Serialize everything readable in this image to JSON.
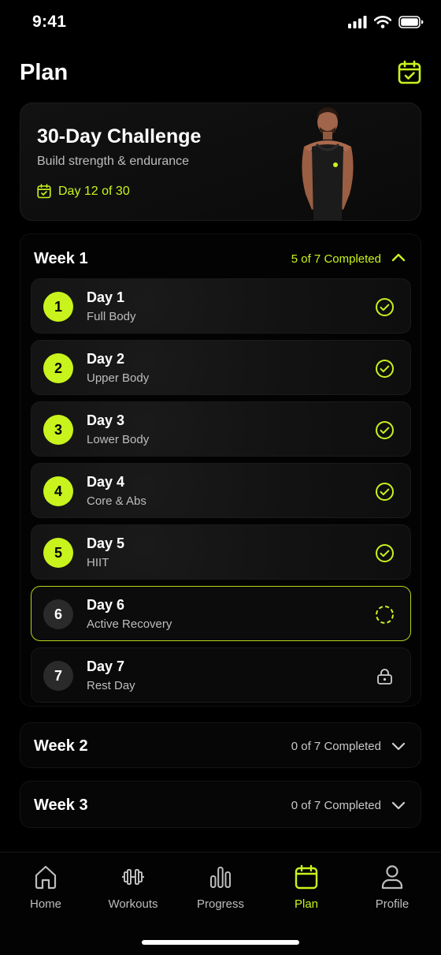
{
  "status_bar": {
    "time": "9:41"
  },
  "header": {
    "title": "Plan"
  },
  "challenge": {
    "title": "30-Day Challenge",
    "subtitle": "Build strength & endurance",
    "day_progress": "Day 12 of 30"
  },
  "weeks": [
    {
      "title": "Week 1",
      "progress": "5 of 7 Completed",
      "expanded": true,
      "days": [
        {
          "number": "1",
          "name": "Day 1",
          "workout": "Full Body",
          "status": "completed"
        },
        {
          "number": "2",
          "name": "Day 2",
          "workout": "Upper Body",
          "status": "completed"
        },
        {
          "number": "3",
          "name": "Day 3",
          "workout": "Lower Body",
          "status": "completed"
        },
        {
          "number": "4",
          "name": "Day 4",
          "workout": "Core & Abs",
          "status": "completed"
        },
        {
          "number": "5",
          "name": "Day 5",
          "workout": "HIIT",
          "status": "completed"
        },
        {
          "number": "6",
          "name": "Day 6",
          "workout": "Active Recovery",
          "status": "in-progress"
        },
        {
          "number": "7",
          "name": "Day 7",
          "workout": "Rest Day",
          "status": "locked"
        }
      ]
    },
    {
      "title": "Week 2",
      "progress": "0 of 7 Completed",
      "expanded": false
    },
    {
      "title": "Week 3",
      "progress": "0 of 7 Completed",
      "expanded": false
    }
  ],
  "tabs": [
    {
      "label": "Home",
      "icon": "home-icon",
      "active": false
    },
    {
      "label": "Workouts",
      "icon": "dumbbell-icon",
      "active": false
    },
    {
      "label": "Progress",
      "icon": "bar-chart-icon",
      "active": false
    },
    {
      "label": "Plan",
      "icon": "calendar-icon",
      "active": true
    },
    {
      "label": "Profile",
      "icon": "user-icon",
      "active": false
    }
  ],
  "colors": {
    "accent": "#c8f31d",
    "background": "#000000",
    "muted_text": "#bdbdbd"
  }
}
